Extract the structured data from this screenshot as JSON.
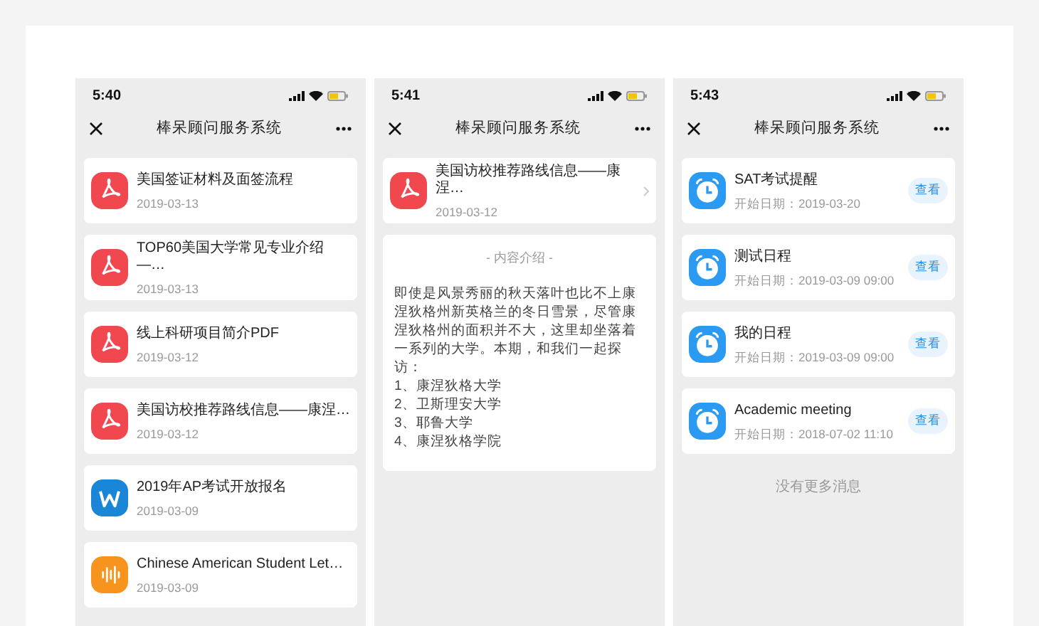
{
  "screens": [
    {
      "kind": "files",
      "time": "5:40",
      "title": "棒呆顾问服务系统",
      "files": [
        {
          "kind": "pdf",
          "name": "美国签证材料及面签流程",
          "date": "2019-03-13"
        },
        {
          "kind": "pdf",
          "name": "TOP60美国大学常见专业介绍—…",
          "date": "2019-03-13"
        },
        {
          "kind": "pdf",
          "name": "线上科研项目简介PDF",
          "date": "2019-03-12"
        },
        {
          "kind": "pdf",
          "name": "美国访校推荐路线信息——康涅…",
          "date": "2019-03-12"
        },
        {
          "kind": "word",
          "name": "2019年AP考试开放报名",
          "date": "2019-03-09"
        },
        {
          "kind": "audio",
          "name": "Chinese American Student Let…",
          "date": "2019-03-09"
        }
      ]
    },
    {
      "kind": "detail",
      "time": "5:41",
      "title": "棒呆顾问服务系统",
      "file": {
        "kind": "pdf",
        "name": "美国访校推荐路线信息——康涅…",
        "date": "2019-03-12"
      },
      "intro_title": "- 内容介绍 -",
      "intro": "即使是风景秀丽的秋天落叶也比不上康涅狄格州新英格兰的冬日雪景，尽管康涅狄格州的面积并不大，这里却坐落着一系列的大学。本期，和我们一起探访：",
      "list": [
        "1、康涅狄格大学",
        "2、卫斯理安大学",
        "3、耶鲁大学",
        "4、康涅狄格学院"
      ]
    },
    {
      "kind": "reminders",
      "time": "5:43",
      "title": "棒呆顾问服务系统",
      "reminders": [
        {
          "name": "SAT考试提醒",
          "start": "开始日期：2019-03-20",
          "action": "查看"
        },
        {
          "name": "测试日程",
          "start": "开始日期：2019-03-09 09:00",
          "action": "查看"
        },
        {
          "name": "我的日程",
          "start": "开始日期：2019-03-09 09:00",
          "action": "查看"
        },
        {
          "name": "Academic meeting",
          "start": "开始日期：2018-07-02 11:10",
          "action": "查看"
        }
      ],
      "footer": "没有更多消息"
    }
  ]
}
